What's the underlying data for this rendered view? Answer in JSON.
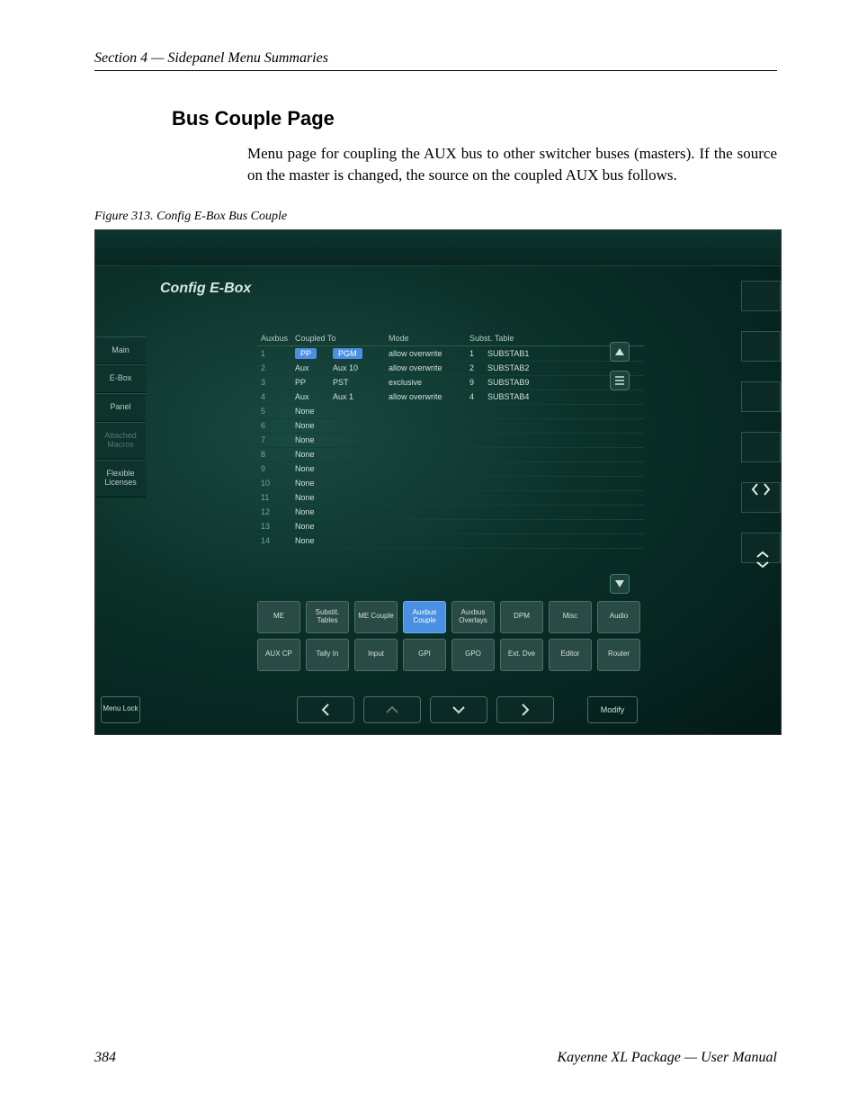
{
  "header": {
    "section": "Section 4 — Sidepanel Menu Summaries"
  },
  "page": {
    "title": "Bus Couple Page",
    "paragraph": "Menu page for coupling the AUX bus to other switcher buses (masters). If the source on the master is changed, the source on the coupled AUX bus follows.",
    "figure_caption": "Figure 313.  Config E-Box Bus Couple"
  },
  "ui": {
    "title": "Config E-Box",
    "left_nav": [
      "Main",
      "E-Box",
      "Panel",
      "Attached Macros",
      "Flexible Licenses"
    ],
    "columns": [
      "Auxbus",
      "Coupled To",
      "",
      "Mode",
      "Subst. Table",
      ""
    ],
    "rows": [
      {
        "n": "1",
        "a": "PP",
        "b": "PGM",
        "mode": "allow overwrite",
        "s1": "1",
        "s2": "SUBSTAB1",
        "sel": true
      },
      {
        "n": "2",
        "a": "Aux",
        "b": "Aux 10",
        "mode": "allow overwrite",
        "s1": "2",
        "s2": "SUBSTAB2"
      },
      {
        "n": "3",
        "a": "PP",
        "b": "PST",
        "mode": "exclusive",
        "s1": "9",
        "s2": "SUBSTAB9"
      },
      {
        "n": "4",
        "a": "Aux",
        "b": "Aux 1",
        "mode": "allow overwrite",
        "s1": "4",
        "s2": "SUBSTAB4"
      },
      {
        "n": "5",
        "a": "None"
      },
      {
        "n": "6",
        "a": "None"
      },
      {
        "n": "7",
        "a": "None"
      },
      {
        "n": "8",
        "a": "None"
      },
      {
        "n": "9",
        "a": "None"
      },
      {
        "n": "10",
        "a": "None"
      },
      {
        "n": "11",
        "a": "None"
      },
      {
        "n": "12",
        "a": "None"
      },
      {
        "n": "13",
        "a": "None"
      },
      {
        "n": "14",
        "a": "None"
      }
    ],
    "buttons_row1": [
      "ME",
      "Substit. Tables",
      "ME Couple",
      "Auxbus Couple",
      "Auxbus Overlays",
      "DPM",
      "Misc",
      "Audio"
    ],
    "buttons_row2": [
      "AUX CP",
      "Tally In",
      "Input",
      "GPI",
      "GPO",
      "Ext. Dve",
      "Editor",
      "Router"
    ],
    "active_button": "Auxbus Couple",
    "menu_lock": "Menu Lock",
    "modify": "Modify"
  },
  "footer": {
    "page_number": "384",
    "doc_title": "Kayenne XL Package — User Manual"
  }
}
